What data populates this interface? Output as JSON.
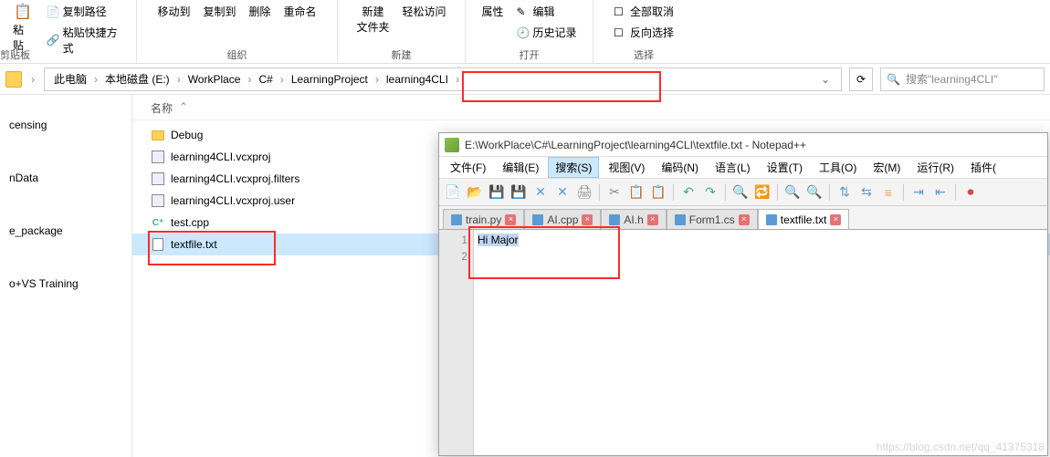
{
  "ribbon": {
    "clipboard_group": "剪贴板",
    "paste": "粘贴",
    "copy_path": "复制路径",
    "paste_shortcut": "粘贴快捷方式",
    "organize_group": "组织",
    "move_to": "移动到",
    "copy_to": "复制到",
    "delete": "删除",
    "rename": "重命名",
    "new_group": "新建",
    "new_folder": "新建\n文件夹",
    "easy_access": "轻松访问",
    "open_group": "打开",
    "properties": "属性",
    "edit": "编辑",
    "history": "历史记录",
    "select_group": "选择",
    "select_all": "全部取消",
    "select_none": "反向选择"
  },
  "breadcrumb": {
    "items": [
      "此电脑",
      "本地磁盘 (E:)",
      "WorkPlace",
      "C#",
      "LearningProject",
      "learning4CLI"
    ]
  },
  "search": {
    "placeholder": "搜索\"learning4CLI\""
  },
  "file_header": {
    "name": "名称"
  },
  "sidebar": {
    "items": [
      {
        "label": "censing"
      },
      {
        "label": "nData"
      },
      {
        "label": "e_package"
      },
      {
        "label": "o+VS Training"
      }
    ]
  },
  "files": [
    {
      "name": "Debug",
      "type": "folder"
    },
    {
      "name": "learning4CLI.vcxproj",
      "type": "proj"
    },
    {
      "name": "learning4CLI.vcxproj.filters",
      "type": "proj"
    },
    {
      "name": "learning4CLI.vcxproj.user",
      "type": "proj"
    },
    {
      "name": "test.cpp",
      "type": "cpp"
    },
    {
      "name": "textfile.txt",
      "type": "txt",
      "selected": true
    }
  ],
  "npp": {
    "title": "E:\\WorkPlace\\C#\\LearningProject\\learning4CLI\\textfile.txt - Notepad++",
    "menu": [
      "文件(F)",
      "编辑(E)",
      "搜索(S)",
      "视图(V)",
      "编码(N)",
      "语言(L)",
      "设置(T)",
      "工具(O)",
      "宏(M)",
      "运行(R)",
      "插件("
    ],
    "menu_active_index": 2,
    "tabs": [
      {
        "label": "train.py",
        "active": false
      },
      {
        "label": "AI.cpp",
        "active": false
      },
      {
        "label": "AI.h",
        "active": false
      },
      {
        "label": "Form1.cs",
        "active": false
      },
      {
        "label": "textfile.txt",
        "active": true
      }
    ],
    "lines": [
      "Hi Major",
      ""
    ],
    "line_numbers": [
      "1",
      "2"
    ]
  },
  "watermark": "https://blog.csdn.net/qq_41375318"
}
